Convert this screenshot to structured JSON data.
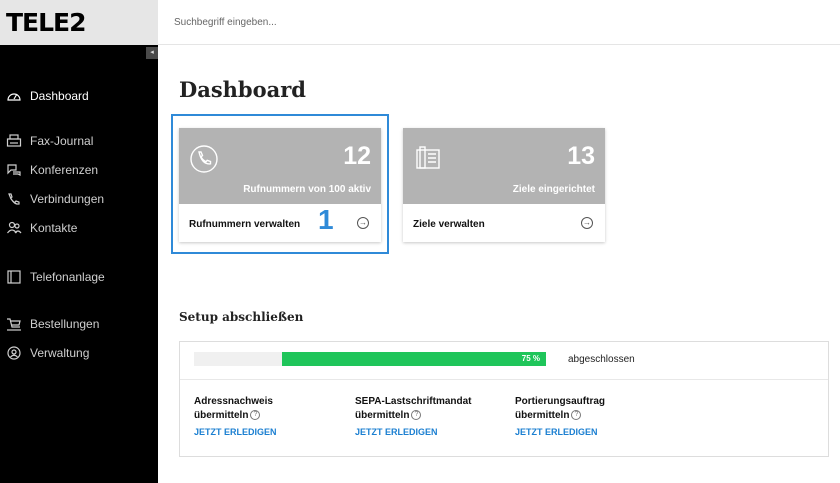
{
  "brand": {
    "logo_text": "TELE2"
  },
  "search": {
    "placeholder": "Suchbegriff eingeben..."
  },
  "sidebar": {
    "collapse_glyph": "◂",
    "items": [
      {
        "label": "Dashboard",
        "icon": "speedometer-icon",
        "active": true
      },
      {
        "label": "Fax-Journal",
        "icon": "fax-icon"
      },
      {
        "label": "Konferenzen",
        "icon": "chat-bubbles-icon"
      },
      {
        "label": "Verbindungen",
        "icon": "phone-icon"
      },
      {
        "label": "Kontakte",
        "icon": "contacts-icon"
      },
      {
        "label": "Telefonanlage",
        "icon": "pbx-icon"
      },
      {
        "label": "Bestellungen",
        "icon": "cart-icon"
      },
      {
        "label": "Verwaltung",
        "icon": "user-circle-icon"
      }
    ]
  },
  "main": {
    "title": "Dashboard",
    "cards": [
      {
        "count": "12",
        "subtitle": "Rufnummern von 100 aktiv",
        "link": "Rufnummern verwalten",
        "icon": "phone-handset-icon"
      },
      {
        "count": "13",
        "subtitle": "Ziele eingerichtet",
        "link": "Ziele verwalten",
        "icon": "desk-phone-icon"
      }
    ],
    "annotation_number": "1",
    "arrow_glyph": "→",
    "setup": {
      "title": "Setup abschließen",
      "progress_percent": 75,
      "progress_label": "75 %",
      "progress_text": "abgeschlossen",
      "help_glyph": "?",
      "tasks": [
        {
          "line1": "Adressnachweis",
          "line2": "übermitteln",
          "action": "JETZT ERLEDIGEN"
        },
        {
          "line1": "SEPA-Lastschriftmandat",
          "line2": "übermitteln",
          "action": "JETZT ERLEDIGEN"
        },
        {
          "line1": "Portierungsauftrag",
          "line2": "übermitteln",
          "action": "JETZT ERLEDIGEN"
        }
      ]
    }
  },
  "colors": {
    "sidebar_bg": "#000000",
    "card_top_bg": "#b3b3b3",
    "progress_green": "#1fc55a",
    "link_blue": "#1b7fd1",
    "highlight_blue": "#2f8ad8"
  }
}
